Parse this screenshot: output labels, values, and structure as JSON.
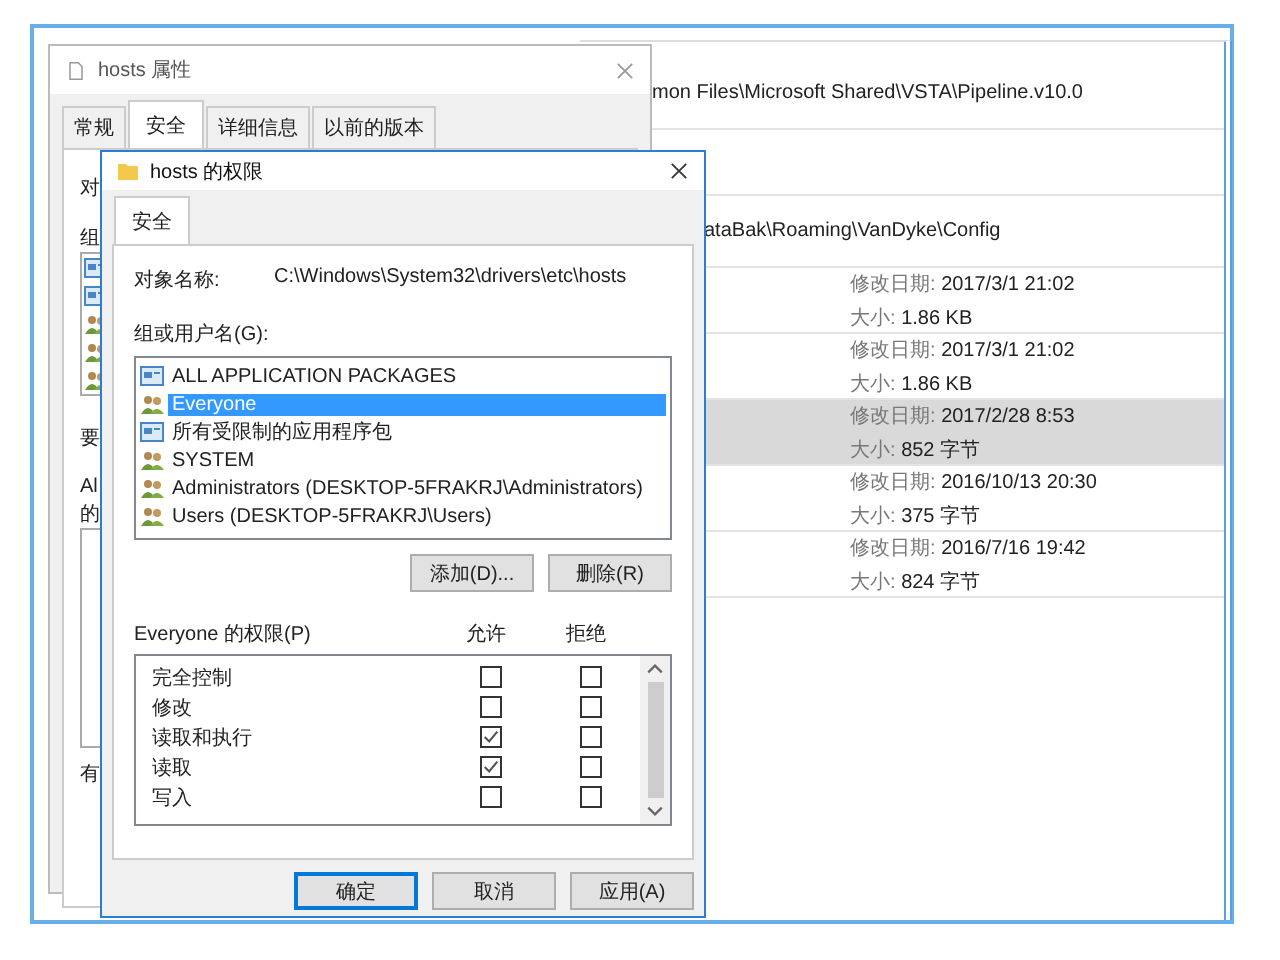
{
  "explorer": {
    "rows": [
      {
        "kind": "path",
        "text": "mon Files\\Microsoft Shared\\VSTA\\Pipeline.v10.0"
      },
      {
        "kind": "blank"
      },
      {
        "kind": "path",
        "text": "ataBak\\Roaming\\VanDyke\\Config"
      },
      {
        "kind": "file",
        "date_label": "修改日期:",
        "date": "2017/3/1 21:02",
        "size_label": "大小:",
        "size": "1.86 KB",
        "selected": false
      },
      {
        "kind": "file",
        "date_label": "修改日期:",
        "date": "2017/3/1 21:02",
        "size_label": "大小:",
        "size": "1.86 KB",
        "selected": false
      },
      {
        "kind": "file",
        "date_label": "修改日期:",
        "date": "2017/2/28 8:53",
        "size_label": "大小:",
        "size": "852 字节",
        "selected": true
      },
      {
        "kind": "file",
        "date_label": "修改日期:",
        "date": "2016/10/13 20:30",
        "size_label": "大小:",
        "size": "375 字节",
        "selected": false
      },
      {
        "kind": "file",
        "date_label": "修改日期:",
        "date": "2016/7/16 19:42",
        "size_label": "大小:",
        "size": "824 字节",
        "selected": false
      }
    ]
  },
  "properties": {
    "title": "hosts 属性",
    "tabs": [
      {
        "label": "常规",
        "selected": false
      },
      {
        "label": "安全",
        "selected": true
      },
      {
        "label": "详细信息",
        "selected": false
      },
      {
        "label": "以前的版本",
        "selected": false
      }
    ],
    "clipped_labels": [
      "对",
      "组",
      "要",
      "Al",
      "的",
      "有"
    ],
    "list_icons": [
      {
        "kind": "package"
      },
      {
        "kind": "package"
      },
      {
        "kind": "user"
      },
      {
        "kind": "user"
      },
      {
        "kind": "user"
      }
    ]
  },
  "permissions": {
    "title": "hosts 的权限",
    "tabs": [
      {
        "label": "安全",
        "selected": true
      }
    ],
    "object_label": "对象名称:",
    "object_path": "C:\\Windows\\System32\\drivers\\etc\\hosts",
    "group_label": "组或用户名(G):",
    "users": [
      {
        "kind": "package",
        "name": "ALL APPLICATION PACKAGES",
        "selected": false
      },
      {
        "kind": "user",
        "name": "Everyone",
        "selected": true
      },
      {
        "kind": "package",
        "name": "所有受限制的应用程序包",
        "selected": false
      },
      {
        "kind": "user",
        "name": "SYSTEM",
        "selected": false
      },
      {
        "kind": "user",
        "name": "Administrators (DESKTOP-5FRAKRJ\\Administrators)",
        "selected": false
      },
      {
        "kind": "user",
        "name": "Users (DESKTOP-5FRAKRJ\\Users)",
        "selected": false
      }
    ],
    "user_buttons": [
      "添加(D)...",
      "删除(R)"
    ],
    "perm_label": "Everyone 的权限(P)",
    "allow_label": "允许",
    "deny_label": "拒绝",
    "perms": [
      {
        "name": "完全控制",
        "allow": false,
        "deny": false
      },
      {
        "name": "修改",
        "allow": false,
        "deny": false
      },
      {
        "name": "读取和执行",
        "allow": true,
        "deny": false
      },
      {
        "name": "读取",
        "allow": true,
        "deny": false
      },
      {
        "name": "写入",
        "allow": false,
        "deny": false
      }
    ],
    "buttons": [
      {
        "label": "确定",
        "default": true
      },
      {
        "label": "取消",
        "default": false
      },
      {
        "label": "应用(A)",
        "default": false
      }
    ]
  }
}
